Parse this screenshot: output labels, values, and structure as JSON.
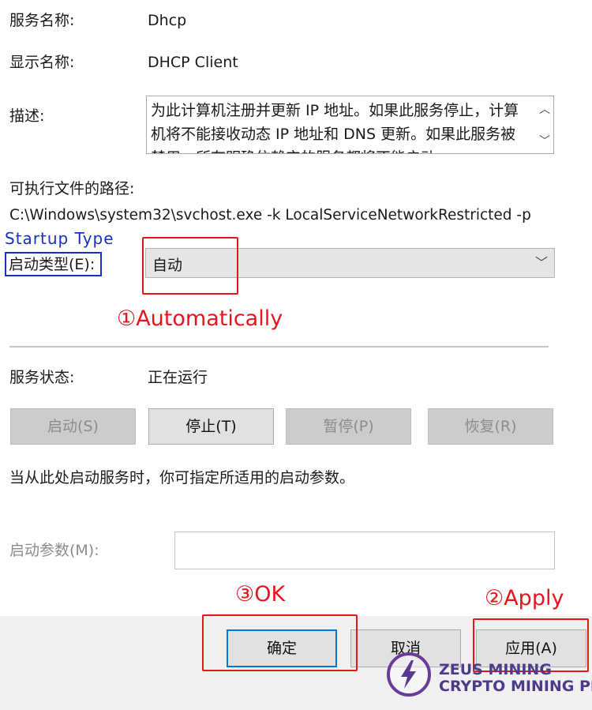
{
  "service_name": {
    "label": "服务名称:",
    "value": "Dhcp"
  },
  "display_name": {
    "label": "显示名称:",
    "value": "DHCP Client"
  },
  "description": {
    "label": "描述:",
    "text": "为此计算机注册并更新 IP 地址。如果此服务停止，计算机将不能接收动态 IP 地址和 DNS 更新。如果此服务被禁用，所有明确依赖它的服务都将不能启动。"
  },
  "executable_path": {
    "label": "可执行文件的路径:",
    "value": "C:\\Windows\\system32\\svchost.exe -k LocalServiceNetworkRestricted -p"
  },
  "startup_type": {
    "label": "启动类型(E):",
    "selected": "自动"
  },
  "service_status": {
    "label": "服务状态:",
    "value": "正在运行"
  },
  "service_buttons": {
    "start": "启动(S)",
    "stop": "停止(T)",
    "pause": "暂停(P)",
    "resume": "恢复(R)"
  },
  "hint_text": "当从此处启动服务时，你可指定所适用的启动参数。",
  "start_params": {
    "label": "启动参数(M):",
    "value": ""
  },
  "dialog_buttons": {
    "ok": "确定",
    "cancel": "取消",
    "apply": "应用(A)"
  },
  "annotations": {
    "startup_type_en": "Startup Type",
    "step1": "①Automatically",
    "step2": "②Apply",
    "step3": "③OK"
  },
  "watermark": {
    "line1": "ZEUS MINING",
    "line2": "CRYPTO MINING PRO"
  },
  "colors": {
    "annotation_red": "#e8141c",
    "annotation_blue": "#1531c8",
    "primary_border": "#0078d7",
    "logo_purple": "#6a3c9a"
  }
}
